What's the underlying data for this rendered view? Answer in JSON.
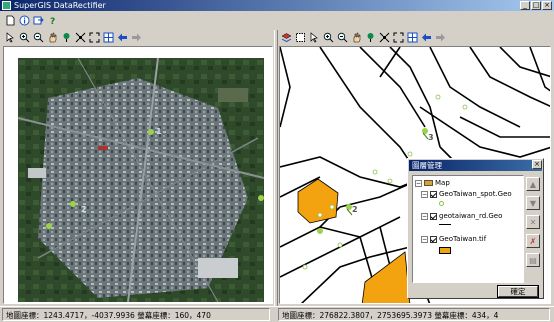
{
  "window": {
    "title": "SuperGIS DataRectifier",
    "min_symbol": "_",
    "max_symbol": "□",
    "close_symbol": "×"
  },
  "main_toolbar": [
    "new-icon",
    "info-icon",
    "export-icon",
    "help-icon"
  ],
  "left_toolbar": [
    "select-icon",
    "zoom-in-icon",
    "zoom-out-icon",
    "pan-icon",
    "add-control-point-icon",
    "full-extent-icon",
    "fit-icon",
    "grid-icon",
    "back-icon",
    "forward-icon"
  ],
  "right_toolbar": [
    "layer-icon",
    "box-select-icon",
    "select-icon",
    "zoom-in-icon",
    "zoom-out-icon",
    "pan-icon",
    "add-control-point-icon",
    "full-extent-icon",
    "fit-icon",
    "grid-icon",
    "back-icon",
    "forward-icon"
  ],
  "image_view": {
    "control_points": [
      "1",
      "2"
    ],
    "colors": {
      "urban": "#5d6a6c",
      "green": "#2f4a2a"
    }
  },
  "map_view": {
    "control_point_labels": [
      "3",
      "2"
    ],
    "colors": {
      "parcel": "#f2a30f",
      "road": "#000000",
      "spot": "#8bc34a"
    }
  },
  "layer_dialog": {
    "title": "圖層管理",
    "close_symbol": "×",
    "root_label": "Map",
    "layers": [
      {
        "label": "GeoTaiwan_spot.Geo"
      },
      {
        "label": "geotaiwan_rd.Geo"
      },
      {
        "label": "GeoTaiwan.tif"
      }
    ],
    "ok_label": "確定",
    "colors": {
      "fill": "#f2a30f"
    }
  },
  "status": {
    "left": "地圖座標：1243.4717，-4037.9936 螢幕座標：160，470",
    "right": "地圖座標：276822.3807，2753695.3973 螢幕座標：434，4"
  }
}
